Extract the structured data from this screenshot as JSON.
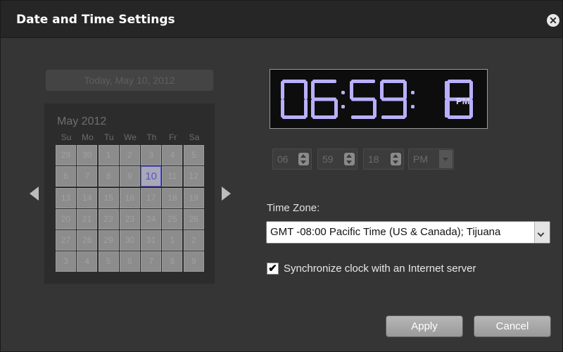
{
  "dialog": {
    "title": "Date and Time Settings",
    "close_icon": "close-icon"
  },
  "calendar": {
    "date_display": "Today, May 10, 2012",
    "month_label": "May 2012",
    "weekdays": [
      "Su",
      "Mo",
      "Tu",
      "We",
      "Th",
      "Fr",
      "Sa"
    ],
    "days": [
      "29",
      "30",
      "1",
      "2",
      "3",
      "4",
      "5",
      "6",
      "7",
      "8",
      "9",
      "10",
      "11",
      "12",
      "13",
      "14",
      "15",
      "16",
      "17",
      "18",
      "19",
      "20",
      "21",
      "22",
      "23",
      "24",
      "25",
      "26",
      "27",
      "28",
      "29",
      "30",
      "31",
      "1",
      "2",
      "3",
      "4",
      "5",
      "6",
      "7",
      "8",
      "9"
    ],
    "selected_day": "10",
    "prev_icon": "triangle-left-icon",
    "next_icon": "triangle-right-icon"
  },
  "clock": {
    "hours": "06",
    "minutes": "59",
    "seconds": "18",
    "period": "PM",
    "digit_color": "#b8b0ff",
    "period_color": "#d4d0ff"
  },
  "time_inputs": {
    "hour": "06",
    "minute": "59",
    "second": "18",
    "period": "PM"
  },
  "timezone": {
    "label": "Time Zone:",
    "value": "GMT -08:00 Pacific Time (US & Canada); Tijuana"
  },
  "sync": {
    "label": "Synchronize clock with an Internet server",
    "checked": true
  },
  "buttons": {
    "apply": "Apply",
    "cancel": "Cancel"
  }
}
